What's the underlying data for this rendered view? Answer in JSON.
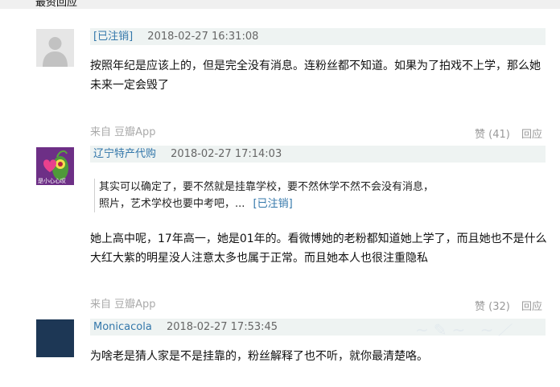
{
  "section": {
    "title": "最资回应"
  },
  "comments": [
    {
      "user": "[已注销]",
      "time": "2018-02-27 16:31:08",
      "text": "按照年纪是应该上的，但是完全没有消息。连粉丝都不知道。如果为了拍戏不上学，那么她未来一定会毁了",
      "source": "来自 豆瓣App",
      "likes": "赞 (41)",
      "reply": "回应"
    },
    {
      "user": "辽宁特产代购",
      "time": "2018-02-27 17:14:03",
      "avatar_caption": "是小心心叹",
      "quote_text": "其实可以确定了，要不然就是挂靠学校，要不然休学不然不会没有消息，照片，艺术学校也要中考吧，...",
      "quote_author": "[已注销]",
      "text": "她上高中呢，17年高一，她是01年的。看微博她的老粉都知道她上学了，而且她也不是什么大红大紫的明星没人注意太多也属于正常。而且她本人也很注重隐私",
      "source": "来自 豆瓣App",
      "likes": "赞 (32)",
      "reply": "回应"
    },
    {
      "user": "Monicacola",
      "time": "2018-02-27 17:53:45",
      "text": "为啥老是猜人家是不是挂靠的，粉丝解释了也不听，就你最清楚咯。"
    }
  ],
  "colors": {
    "link": "#3377aa",
    "meta_bg": "#eef3f2",
    "muted": "#aaaaaa"
  }
}
